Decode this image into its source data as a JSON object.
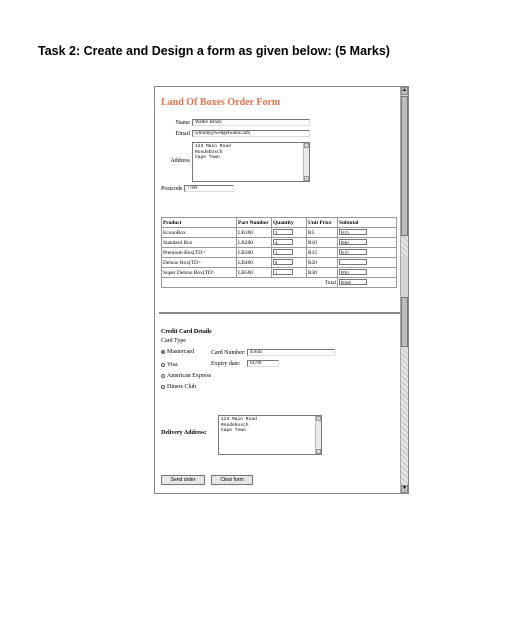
{
  "heading": "Task 2: Create and Design a form as given below: (5 Marks)",
  "form": {
    "title": "Land Of Boxes Order Form",
    "name_label": "Name",
    "name_value": "Walter Brody",
    "email_label": "Email",
    "email_value": "wbrody@wedgetwater.com",
    "address_label": "Address",
    "address_lines": [
      "123 Main Road",
      "Rondebosch",
      "Cape Town"
    ],
    "postcode_label": "Postcode",
    "postcode_value": "7700"
  },
  "products": {
    "headers": [
      "Product",
      "Part Number",
      "Quantity",
      "Unit Price",
      "Subtotal"
    ],
    "rows": [
      {
        "product": "EconoBox",
        "part": "LB100",
        "qty": "3",
        "price": "R5",
        "subtotal": "R15"
      },
      {
        "product": "Standard Box",
        "part": "LB200",
        "qty": "4",
        "price": "R10",
        "subtotal": "R40"
      },
      {
        "product": "Premium Box(TD>",
        "part": "LB300",
        "qty": "1",
        "price": "R15",
        "subtotal": "R15"
      },
      {
        "product": "Deluxe Box(TD>",
        "part": "LB400",
        "qty": "8",
        "price": "R20",
        "subtotal": ""
      },
      {
        "product": "Super Deluxe Box(TD>",
        "part": "LB500",
        "qty": "1",
        "price": "R30",
        "subtotal": "R30"
      }
    ],
    "total_label": "Total",
    "total_value": "R360"
  },
  "credit": {
    "title": "Credit Card Details",
    "type_label": "Card Type",
    "options": [
      "Mastercard",
      "Visa",
      "American Express",
      "Diners Club"
    ],
    "selected": "Mastercard",
    "card_number_label": "Card Number:",
    "card_number_value": "45645",
    "expiry_label": "Expiry date:",
    "expiry_value": "01/99"
  },
  "delivery": {
    "label": "Delivery Address:",
    "lines": [
      "123 Main Road",
      "Rondebosch",
      "Cape Town"
    ]
  },
  "buttons": {
    "send": "Send order",
    "clear": "Clear form"
  }
}
